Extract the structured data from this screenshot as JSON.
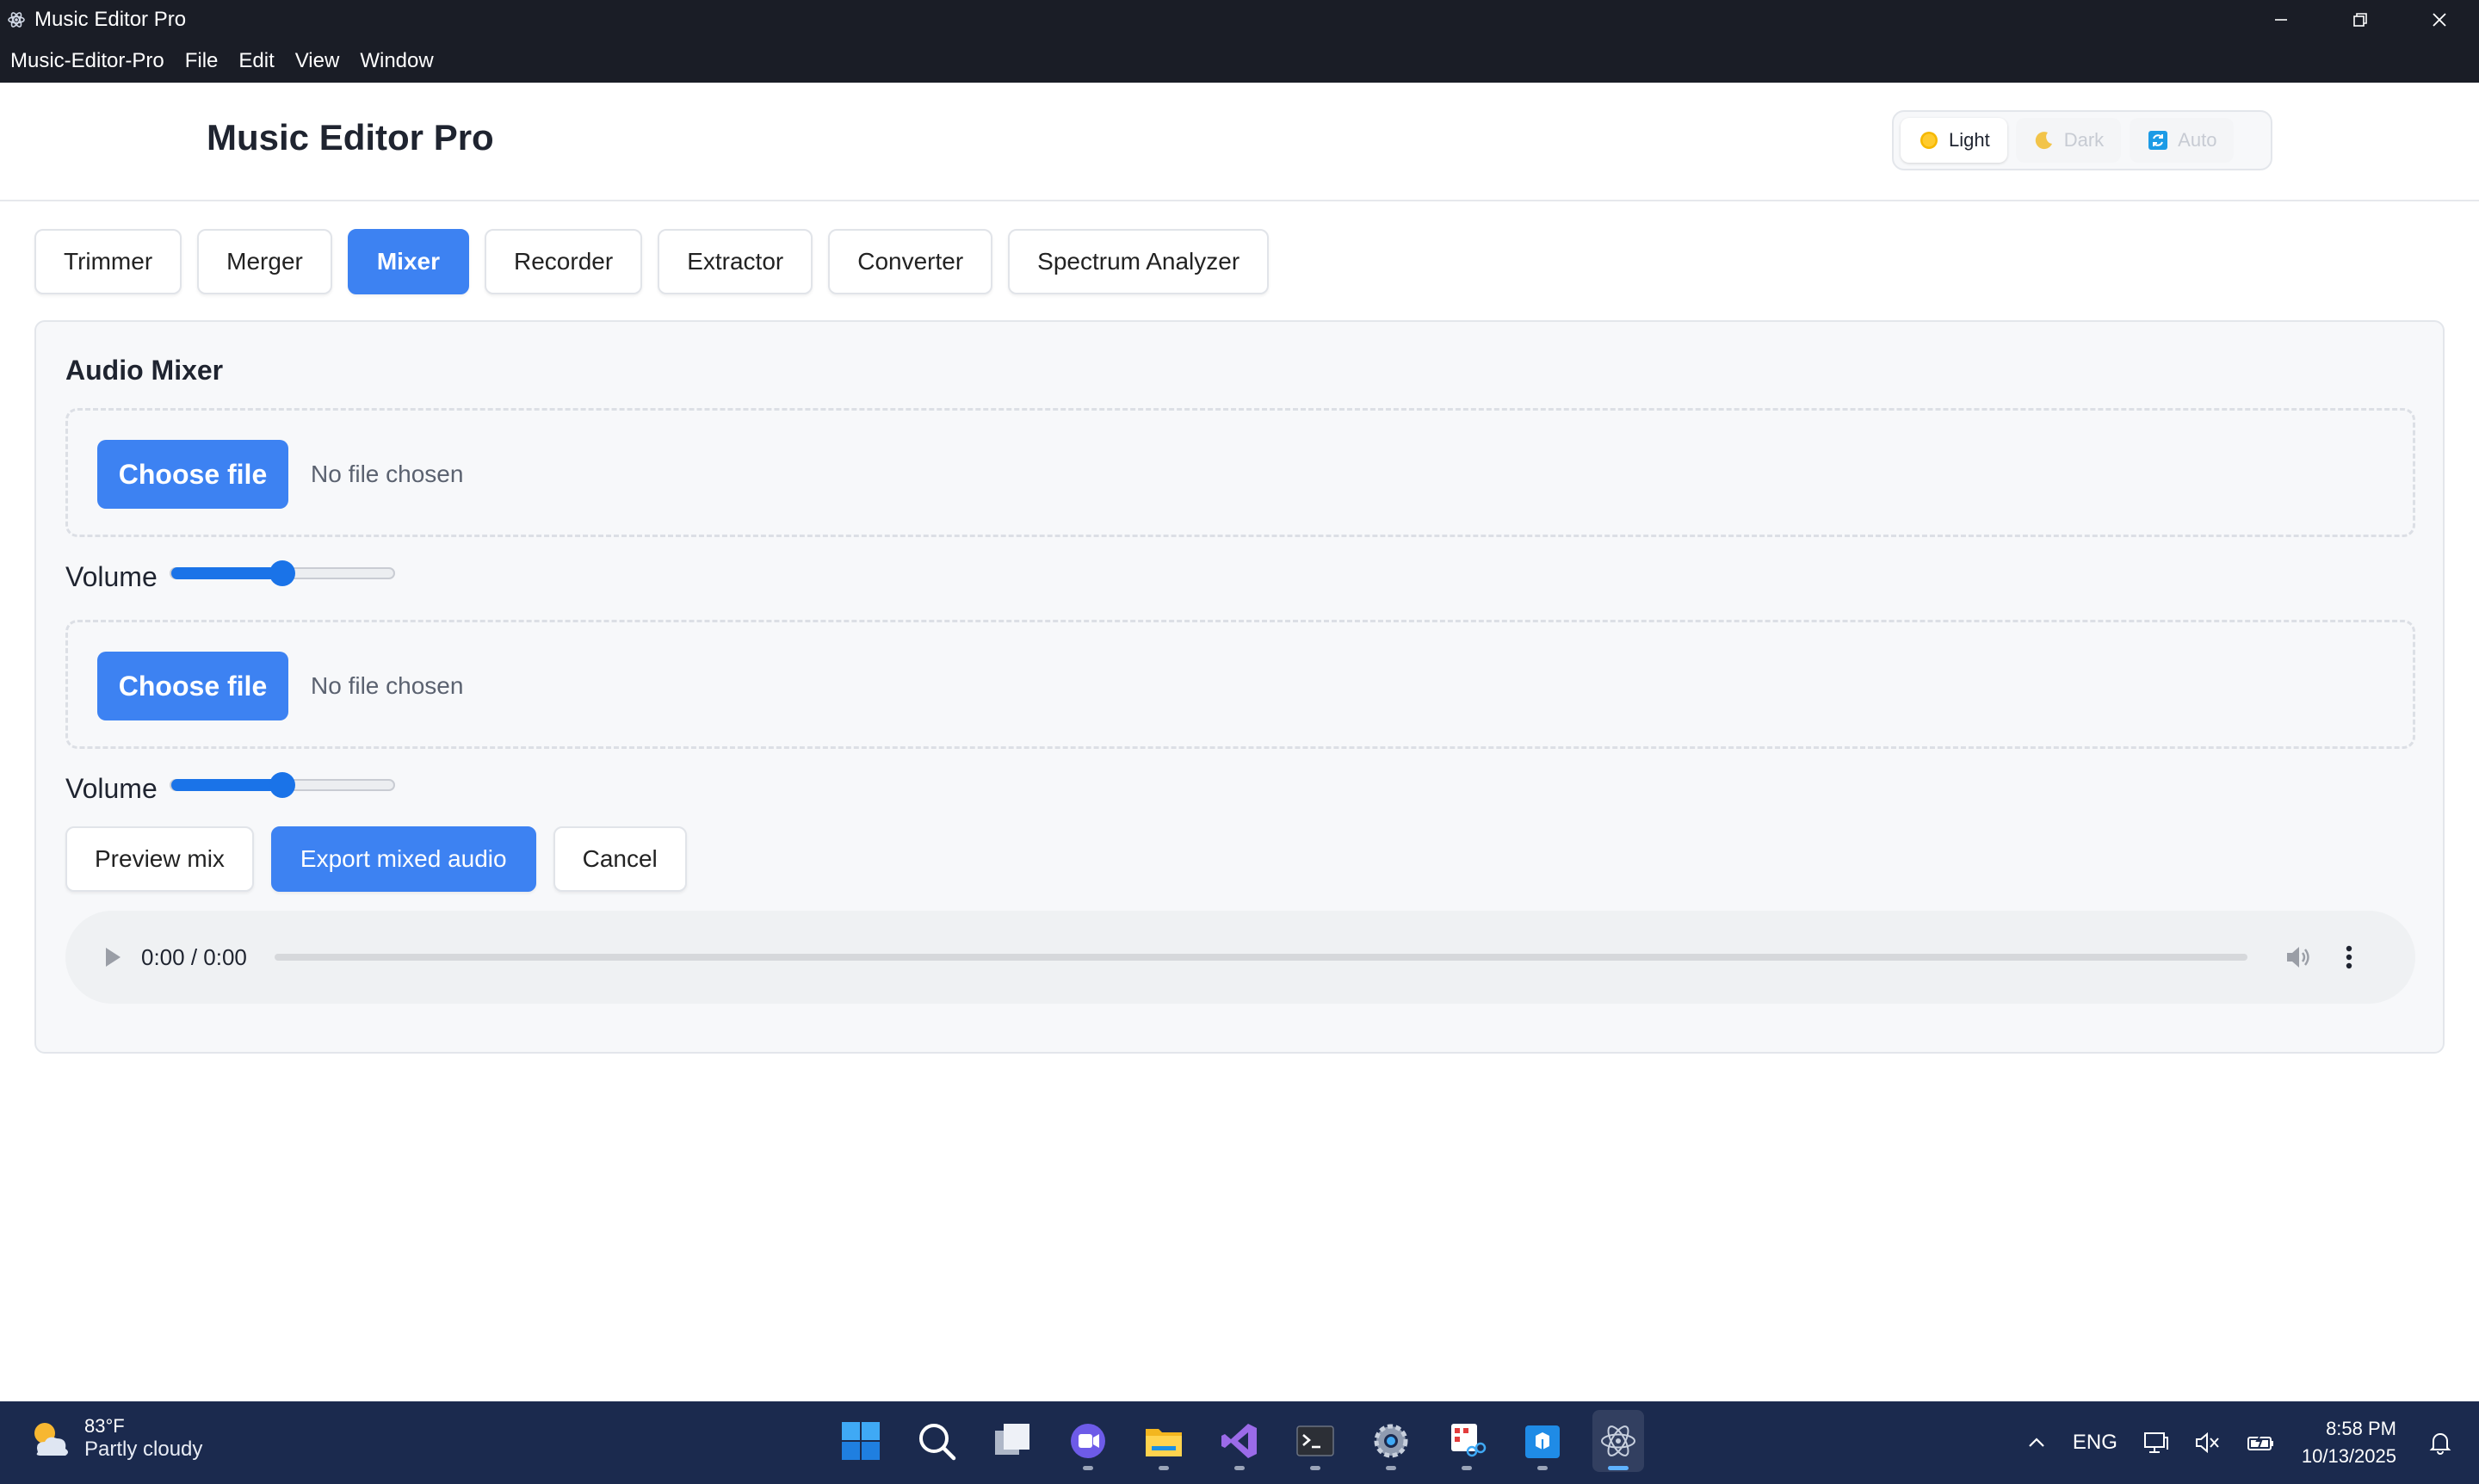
{
  "window": {
    "title": "Music Editor Pro"
  },
  "menu": [
    "Music-Editor-Pro",
    "File",
    "Edit",
    "View",
    "Window"
  ],
  "header": {
    "title": "Music Editor Pro",
    "theme": {
      "light": "Light",
      "dark": "Dark",
      "auto": "Auto",
      "selected": "Light"
    }
  },
  "tabs": [
    "Trimmer",
    "Merger",
    "Mixer",
    "Recorder",
    "Extractor",
    "Converter",
    "Spectrum Analyzer"
  ],
  "active_tab": "Mixer",
  "mixer": {
    "title": "Audio Mixer",
    "tracks": [
      {
        "button": "Choose file",
        "status": "No file chosen",
        "volume_label": "Volume",
        "volume": 0.5
      },
      {
        "button": "Choose file",
        "status": "No file chosen",
        "volume_label": "Volume",
        "volume": 0.5
      }
    ],
    "actions": {
      "preview": "Preview mix",
      "export": "Export mixed audio",
      "cancel": "Cancel"
    },
    "player": {
      "time": "0:00 / 0:00"
    }
  },
  "taskbar": {
    "weather": {
      "temp": "83°F",
      "condition": "Partly cloudy"
    },
    "apps": [
      "start-icon",
      "search-icon",
      "task-view-icon",
      "teams-icon",
      "file-explorer-icon",
      "visual-studio-icon",
      "terminal-icon",
      "settings-icon",
      "snipping-tool-icon",
      "store-icon",
      "electron-app-icon"
    ],
    "language": "ENG",
    "time": "8:58 PM",
    "date": "10/13/2025"
  },
  "colors": {
    "accent": "#3d82f2",
    "titlebar": "#1a1d26",
    "taskbar": "#1b2a4e",
    "slider": "#1a73e8"
  }
}
